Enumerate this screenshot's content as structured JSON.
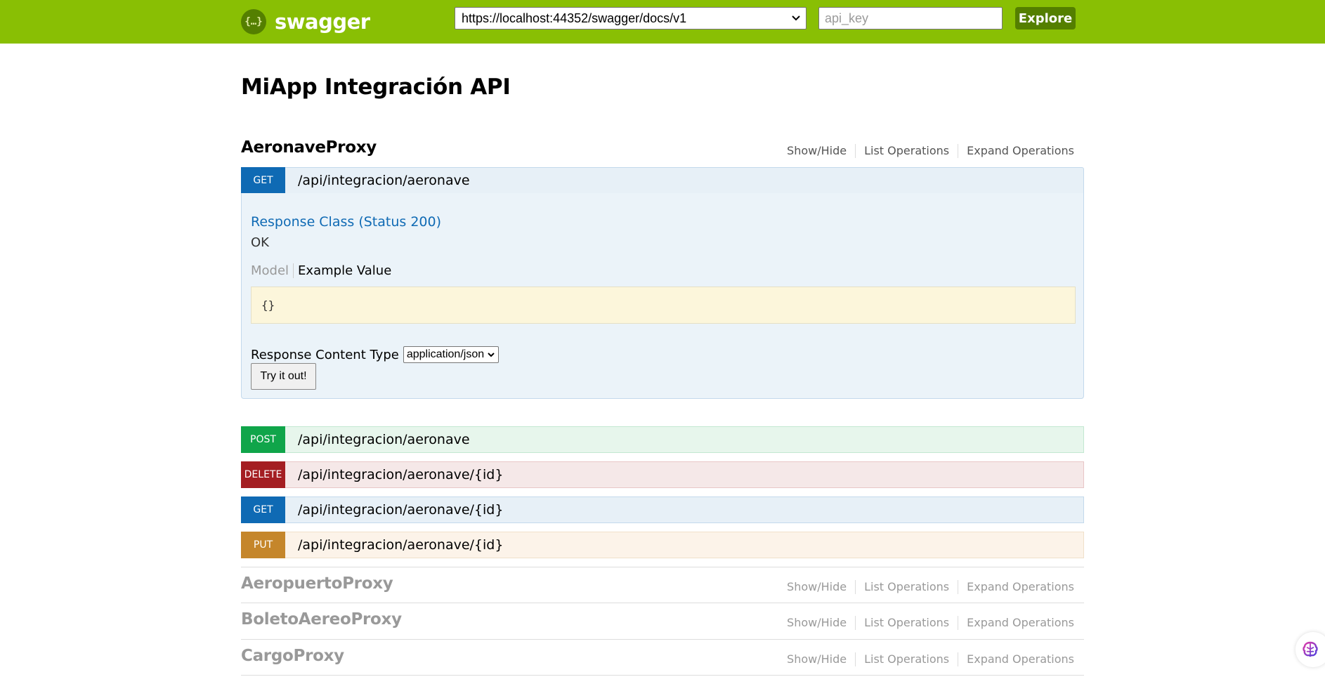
{
  "header": {
    "logo_text": "swagger",
    "url_value": "https://localhost:44352/swagger/docs/v1",
    "api_key_placeholder": "api_key",
    "explore_label": "Explore"
  },
  "title": "MiApp Integración API",
  "resource_links": {
    "show_hide": "Show/Hide",
    "list": "List Operations",
    "expand": "Expand Operations"
  },
  "resources": [
    {
      "name": "AeronaveProxy"
    },
    {
      "name": "AeropuertoProxy"
    },
    {
      "name": "BoletoAereoProxy"
    },
    {
      "name": "CargoProxy"
    }
  ],
  "operations": [
    {
      "method": "GET",
      "path": "/api/integracion/aeronave"
    },
    {
      "method": "POST",
      "path": "/api/integracion/aeronave"
    },
    {
      "method": "DELETE",
      "path": "/api/integracion/aeronave/{id}"
    },
    {
      "method": "GET",
      "path": "/api/integracion/aeronave/{id}"
    },
    {
      "method": "PUT",
      "path": "/api/integracion/aeronave/{id}"
    }
  ],
  "expanded": {
    "response_class": "Response Class (Status 200)",
    "status_text": "OK",
    "tab_model": "Model",
    "tab_example": "Example Value",
    "example_body": "{}",
    "content_type_label": "Response Content Type",
    "content_type_value": "application/json",
    "try_label": "Try it out!"
  },
  "colors": {
    "header": "#89bf04",
    "get": "#0f6ab4",
    "post": "#10a54a",
    "delete": "#a41e22",
    "put": "#c5862b"
  }
}
